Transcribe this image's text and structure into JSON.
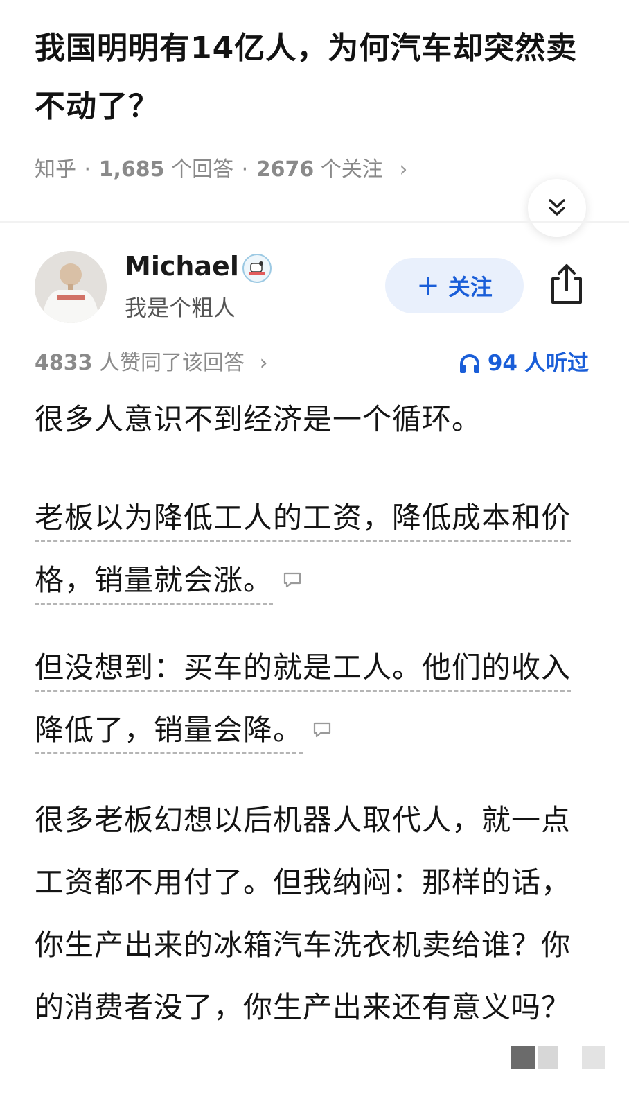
{
  "question": {
    "title": "我国明明有14亿人，为何汽车却突然卖不动了？",
    "source": "知乎",
    "answers_count": "1,685",
    "answers_label": "个回答",
    "followers_count": "2676",
    "followers_label": "个关注",
    "dot": "·",
    "chevron": "›"
  },
  "author": {
    "name": "Michael",
    "bio": "我是个粗人",
    "follow_label": "关注",
    "follow_plus": "+"
  },
  "answer": {
    "votes_count": "4833",
    "votes_label": "人赞同了该回答",
    "listen_count": "94",
    "listen_label": "人听过",
    "paragraphs": [
      "很多人意识不到经济是一个循环。",
      "老板以为降低工人的工资，降低成本和价格，销量就会涨。",
      "但没想到：买车的就是工人。他们的收入降低了，销量会降。",
      "很多老板幻想以后机器人取代人，就一点工资都不用付了。但我纳闷：那样的话，你生产出来的冰箱汽车洗衣机卖给谁？你的消费者没了，你生产出来还有意义吗？"
    ]
  },
  "colors": {
    "accent": "#1a5ed8",
    "meta_gray": "#8a8a8a",
    "follow_bg": "#e9f0fc"
  },
  "icons": [
    "chevron-double-down-icon",
    "share-icon",
    "headphones-icon",
    "comment-icon",
    "verified-badge-icon"
  ]
}
